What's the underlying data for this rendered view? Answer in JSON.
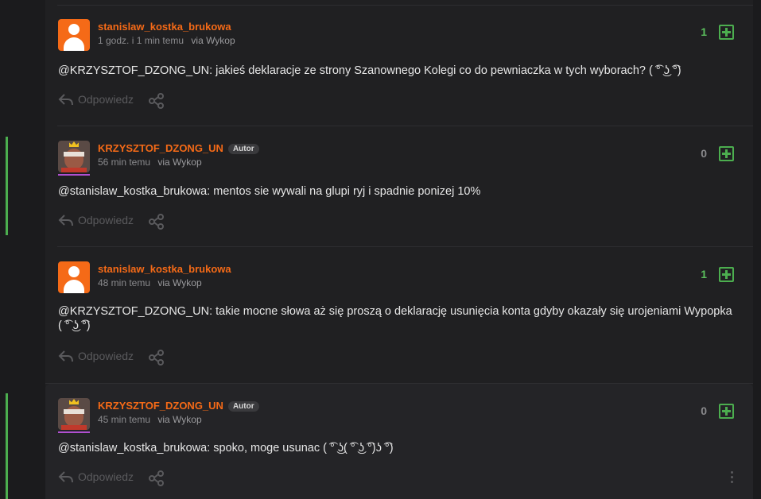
{
  "comments": [
    {
      "author": "stanislaw_kostka_brukowa",
      "time": "1 godz. i 1 min temu",
      "via": "via Wykop",
      "votes": "1",
      "mention": "@KRZYSZTOF_DZONG_UN",
      "text": ": jakieś deklaracje ze strony Szanownego Kolegi co do pewniaczka w tych wyborach? ( ͡° ͜ʖ ͡°)",
      "reply_label": "Odpowiedz"
    },
    {
      "author": "KRZYSZTOF_DZONG_UN",
      "badge": "Autor",
      "time": "56 min temu",
      "via": "via Wykop",
      "votes": "0",
      "mention": "@stanislaw_kostka_brukowa",
      "text": ": mentos sie wywali na glupi ryj i spadnie ponizej 10%",
      "reply_label": "Odpowiedz"
    },
    {
      "author": "stanislaw_kostka_brukowa",
      "time": "48 min temu",
      "via": "via Wykop",
      "votes": "1",
      "mention": "@KRZYSZTOF_DZONG_UN",
      "text": ": takie mocne słowa aż się proszą o deklarację usunięcia konta gdyby okazały się urojeniami Wypopka",
      "text_line2": "( ͡° ͜ʖ ͡°)",
      "reply_label": "Odpowiedz"
    },
    {
      "author": "KRZYSZTOF_DZONG_UN",
      "badge": "Autor",
      "time": "45 min temu",
      "via": "via Wykop",
      "votes": "0",
      "mention": "@stanislaw_kostka_brukowa",
      "text": ": spoko, moge usunac ( ͡° ͜ʖ( ͡° ͜ʖ ͡°)ʖ ͡°)",
      "reply_label": "Odpowiedz"
    }
  ],
  "icons": {
    "reply": "reply-icon",
    "share": "share-icon",
    "plus": "plus-square-icon",
    "more": "more-vertical-icon"
  },
  "colors": {
    "author": "#f56a17",
    "positive_votes": "#5bbf5d",
    "accent_green": "#4cae4f",
    "background": "#1b1b1d"
  }
}
